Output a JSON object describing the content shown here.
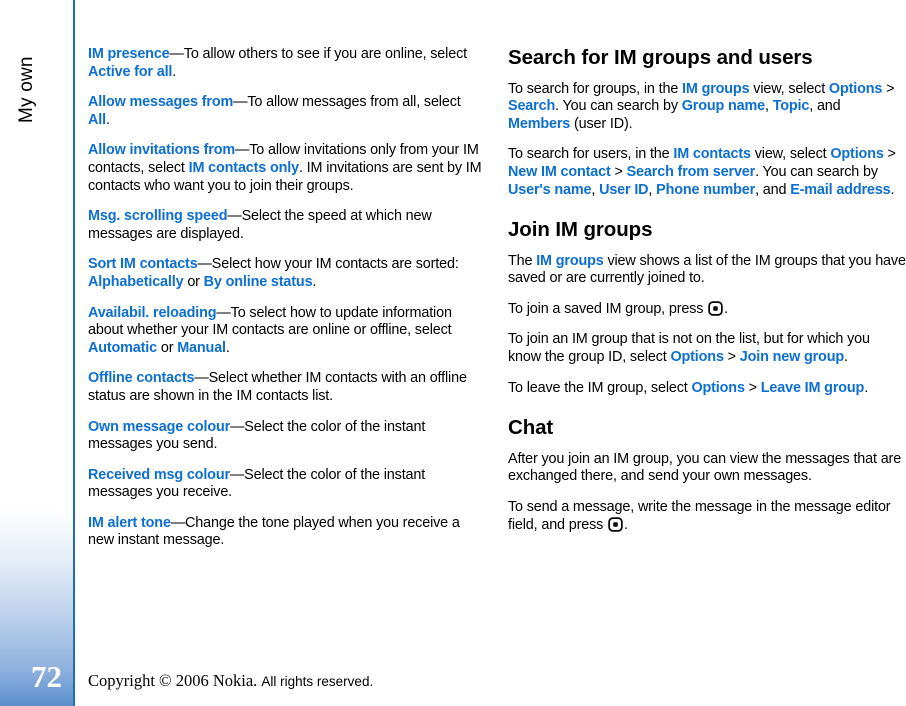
{
  "sidebar": {
    "chapter_label": "My own",
    "page_number": "72",
    "gradient_bottom_color": "#5b8fcc",
    "rule_color": "#1b6fb8"
  },
  "colors": {
    "term_blue": "#0d6fd1",
    "body_black": "#000000"
  },
  "icons": {
    "scroll_key": "scroll-key-icon"
  },
  "left_column": {
    "paragraphs": [
      {
        "id": "im-presence",
        "runs": [
          {
            "t": "IM presence",
            "s": "term"
          },
          {
            "t": "—To allow others to see if you are online, select ",
            "s": "body"
          },
          {
            "t": "Active for all",
            "s": "term"
          },
          {
            "t": ".",
            "s": "body"
          }
        ]
      },
      {
        "id": "allow-messages-from",
        "runs": [
          {
            "t": "Allow messages from",
            "s": "term"
          },
          {
            "t": "—To allow messages from all, select ",
            "s": "body"
          },
          {
            "t": "All",
            "s": "term"
          },
          {
            "t": ".",
            "s": "body"
          }
        ]
      },
      {
        "id": "allow-invitations-from",
        "runs": [
          {
            "t": "Allow invitations from",
            "s": "term"
          },
          {
            "t": "—To allow invitations only from your IM contacts, select ",
            "s": "body"
          },
          {
            "t": "IM contacts only",
            "s": "term"
          },
          {
            "t": ". IM invitations are sent by IM contacts who want you to join their groups.",
            "s": "body"
          }
        ]
      },
      {
        "id": "msg-scrolling-speed",
        "runs": [
          {
            "t": "Msg. scrolling speed",
            "s": "term"
          },
          {
            "t": "—Select the speed at which new messages are displayed.",
            "s": "body"
          }
        ]
      },
      {
        "id": "sort-im-contacts",
        "runs": [
          {
            "t": "Sort IM contacts",
            "s": "term"
          },
          {
            "t": "—Select how your IM contacts are sorted: ",
            "s": "body"
          },
          {
            "t": "Alphabetically",
            "s": "term"
          },
          {
            "t": " or ",
            "s": "body"
          },
          {
            "t": "By online status",
            "s": "term"
          },
          {
            "t": ".",
            "s": "body"
          }
        ]
      },
      {
        "id": "availabil-reloading",
        "runs": [
          {
            "t": "Availabil. reloading",
            "s": "term"
          },
          {
            "t": "—To select how to update information about whether your IM contacts are online or offline, select ",
            "s": "body"
          },
          {
            "t": "Automatic",
            "s": "term"
          },
          {
            "t": " or ",
            "s": "body"
          },
          {
            "t": "Manual",
            "s": "term"
          },
          {
            "t": ".",
            "s": "body"
          }
        ]
      },
      {
        "id": "offline-contacts",
        "runs": [
          {
            "t": "Offline contacts",
            "s": "term"
          },
          {
            "t": "—Select whether IM contacts with an offline status are shown in the IM contacts list.",
            "s": "body"
          }
        ]
      },
      {
        "id": "own-message-colour",
        "runs": [
          {
            "t": "Own message colour",
            "s": "term"
          },
          {
            "t": "—Select the color of the instant messages you send.",
            "s": "body"
          }
        ]
      },
      {
        "id": "received-msg-colour",
        "runs": [
          {
            "t": "Received msg colour",
            "s": "term"
          },
          {
            "t": "—Select the color of the instant messages you receive.",
            "s": "body"
          }
        ]
      },
      {
        "id": "im-alert-tone",
        "runs": [
          {
            "t": "IM alert tone",
            "s": "term"
          },
          {
            "t": "—Change the tone played when you receive a new instant message.",
            "s": "body"
          }
        ]
      }
    ]
  },
  "right_column": {
    "blocks": [
      {
        "type": "heading",
        "id": "search-for-im-groups-and-users",
        "text": "Search for IM groups and users"
      },
      {
        "type": "paragraph",
        "id": "search-groups",
        "runs": [
          {
            "t": "To search for groups, in the ",
            "s": "body"
          },
          {
            "t": "IM groups",
            "s": "term"
          },
          {
            "t": " view, select ",
            "s": "body"
          },
          {
            "t": "Options",
            "s": "term"
          },
          {
            "t": " > ",
            "s": "sep"
          },
          {
            "t": "Search",
            "s": "term"
          },
          {
            "t": ". You can search by ",
            "s": "body"
          },
          {
            "t": "Group name",
            "s": "term"
          },
          {
            "t": ", ",
            "s": "body"
          },
          {
            "t": "Topic",
            "s": "term"
          },
          {
            "t": ", and ",
            "s": "body"
          },
          {
            "t": "Members",
            "s": "term"
          },
          {
            "t": " (user ID).",
            "s": "body"
          }
        ]
      },
      {
        "type": "paragraph",
        "id": "search-users",
        "runs": [
          {
            "t": "To search for users, in the ",
            "s": "body"
          },
          {
            "t": "IM contacts",
            "s": "term"
          },
          {
            "t": " view, select ",
            "s": "body"
          },
          {
            "t": "Options",
            "s": "term"
          },
          {
            "t": " > ",
            "s": "sep"
          },
          {
            "t": "New IM contact",
            "s": "term"
          },
          {
            "t": " > ",
            "s": "sep"
          },
          {
            "t": "Search from server",
            "s": "term"
          },
          {
            "t": ". You can search by ",
            "s": "body"
          },
          {
            "t": "User's name",
            "s": "term"
          },
          {
            "t": ", ",
            "s": "body"
          },
          {
            "t": "User ID",
            "s": "term"
          },
          {
            "t": ", ",
            "s": "body"
          },
          {
            "t": "Phone number",
            "s": "term"
          },
          {
            "t": ", and ",
            "s": "body"
          },
          {
            "t": "E-mail address",
            "s": "term"
          },
          {
            "t": ".",
            "s": "body"
          }
        ]
      },
      {
        "type": "heading",
        "id": "join-im-groups",
        "text": "Join IM groups"
      },
      {
        "type": "paragraph",
        "id": "im-groups-view-desc",
        "runs": [
          {
            "t": "The ",
            "s": "body"
          },
          {
            "t": "IM groups",
            "s": "term"
          },
          {
            "t": " view shows a list of the IM groups that you have saved or are currently joined to.",
            "s": "body"
          }
        ]
      },
      {
        "type": "paragraph",
        "id": "join-saved-group",
        "runs": [
          {
            "t": "To join a saved IM group, press ",
            "s": "body"
          },
          {
            "t": "",
            "s": "icon"
          },
          {
            "t": ".",
            "s": "body"
          }
        ]
      },
      {
        "type": "paragraph",
        "id": "join-new-group",
        "runs": [
          {
            "t": "To join an IM group that is not on the list, but for which you know the group ID, select ",
            "s": "body"
          },
          {
            "t": "Options",
            "s": "term"
          },
          {
            "t": " > ",
            "s": "sep"
          },
          {
            "t": "Join new group",
            "s": "term"
          },
          {
            "t": ".",
            "s": "body"
          }
        ]
      },
      {
        "type": "paragraph",
        "id": "leave-im-group",
        "runs": [
          {
            "t": "To leave the IM group, select ",
            "s": "body"
          },
          {
            "t": "Options",
            "s": "term"
          },
          {
            "t": " > ",
            "s": "sep"
          },
          {
            "t": "Leave IM group",
            "s": "term"
          },
          {
            "t": ".",
            "s": "body"
          }
        ]
      },
      {
        "type": "heading",
        "id": "chat",
        "text": "Chat"
      },
      {
        "type": "paragraph",
        "id": "chat-intro",
        "runs": [
          {
            "t": "After you join an IM group, you can view the messages that are exchanged there, and send your own messages.",
            "s": "body"
          }
        ]
      },
      {
        "type": "paragraph",
        "id": "send-message",
        "runs": [
          {
            "t": "To send a message, write the message in the message editor field, and press ",
            "s": "body"
          },
          {
            "t": "",
            "s": "icon"
          },
          {
            "t": ".",
            "s": "body"
          }
        ]
      }
    ]
  },
  "footer": {
    "copyright_serif": "Copyright © 2006 Nokia.",
    "rights_sans": "All rights reserved."
  }
}
